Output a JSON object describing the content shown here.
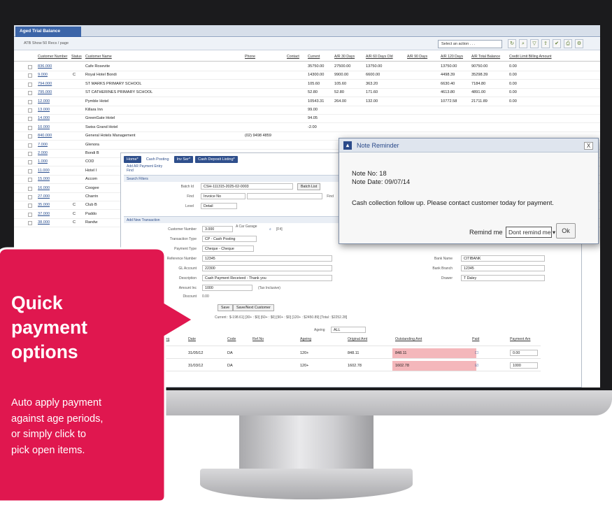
{
  "app": {
    "tab_title": "Aged Trial Balance",
    "toolbar_left": "ATB   Show  50  Recs / page",
    "action_select": "Select an action . . ."
  },
  "grid": {
    "columns": [
      "Customer Number",
      "Status",
      "Customer Name",
      "Phone",
      "Contact",
      "Current",
      "A/R 30 Days",
      "A/R 60 Days Old",
      "A/R 90 Days",
      "A/R 120 Days",
      "A/R Total Balance",
      "Credit Limit Billing Amount"
    ],
    "rows": [
      {
        "num": "836.000",
        "status": "",
        "name": "Cafe Rosevite",
        "phone": "",
        "current": "35750.00",
        "d30": "27500.00",
        "d60": "13750.00",
        "d120": "13750.00",
        "total": "90750.00",
        "credit": "0.00"
      },
      {
        "num": "9.000",
        "status": "C",
        "name": "Royal Hotel Bondi",
        "phone": "",
        "current": "14300.00",
        "d30": "9900.00",
        "d60": "6600.00",
        "d120": "4498.39",
        "total": "35298.39",
        "credit": "0.00"
      },
      {
        "num": "794.000",
        "status": "",
        "name": "ST MARKS PRIMARY SCHOOL",
        "phone": "",
        "current": "105.60",
        "d30": "105.60",
        "d60": "363.20",
        "d120": "6630.40",
        "total": "7184.80",
        "credit": "0.00"
      },
      {
        "num": "795.000",
        "status": "",
        "name": "ST CATHERINES PRIMARY SCHOOL",
        "phone": "",
        "current": "52.80",
        "d30": "52.80",
        "d60": "171.60",
        "d120": "4613.80",
        "total": "4891.00",
        "credit": "0.00"
      },
      {
        "num": "12.000",
        "status": "",
        "name": "Pymble Hotel",
        "phone": "",
        "current": "10543.31",
        "d30": "264.00",
        "d60": "132.00",
        "d120": "10772.58",
        "total": "21711.89",
        "credit": "0.00"
      },
      {
        "num": "13.000",
        "status": "",
        "name": "Killara Inn",
        "phone": "",
        "current": "99.00",
        "d30": "",
        "d60": "",
        "d120": "",
        "total": "",
        "credit": ""
      },
      {
        "num": "14.000",
        "status": "",
        "name": "GreenGate Hotel",
        "phone": "",
        "current": "94.05",
        "d30": "",
        "d60": "",
        "d120": "",
        "total": "",
        "credit": ""
      },
      {
        "num": "10.000",
        "status": "",
        "name": "Swiss Grand Hotel",
        "phone": "",
        "current": "-2.00",
        "d30": "",
        "d60": "",
        "d120": "",
        "total": "",
        "credit": ""
      },
      {
        "num": "840.000",
        "status": "",
        "name": "General Hotels Management",
        "phone": "(02) 9498 4859",
        "current": "",
        "d30": "",
        "d60": "",
        "d120": "",
        "total": "",
        "credit": ""
      },
      {
        "num": "7.000",
        "status": "",
        "name": "Glenora",
        "phone": "",
        "current": "",
        "d30": "",
        "d60": "",
        "d120": "",
        "total": "",
        "credit": ""
      },
      {
        "num": "2.000",
        "status": "",
        "name": "Bondi B",
        "phone": "",
        "current": "",
        "d30": "",
        "d60": "",
        "d120": "",
        "total": "",
        "credit": ""
      },
      {
        "num": "1.000",
        "status": "",
        "name": "COD",
        "phone": "",
        "current": "",
        "d30": "",
        "d60": "",
        "d120": "",
        "total": "",
        "credit": ""
      },
      {
        "num": "11.000",
        "status": "",
        "name": "Hotel I",
        "phone": "",
        "current": "",
        "d30": "",
        "d60": "",
        "d120": "",
        "total": "",
        "credit": ""
      },
      {
        "num": "15.000",
        "status": "",
        "name": "Accom",
        "phone": "",
        "current": "",
        "d30": "",
        "d60": "",
        "d120": "",
        "total": "",
        "credit": ""
      },
      {
        "num": "16.000",
        "status": "",
        "name": "Coogee",
        "phone": "",
        "current": "",
        "d30": "",
        "d60": "",
        "d120": "",
        "total": "",
        "credit": ""
      },
      {
        "num": "27.000",
        "status": "",
        "name": "Charrin",
        "phone": "",
        "current": "",
        "d30": "",
        "d60": "",
        "d120": "",
        "total": "",
        "credit": ""
      },
      {
        "num": "35.000",
        "status": "C",
        "name": "Club B",
        "phone": "",
        "current": "",
        "d30": "",
        "d60": "",
        "d120": "",
        "total": "",
        "credit": ""
      },
      {
        "num": "37.000",
        "status": "C",
        "name": "Paddo",
        "phone": "",
        "current": "",
        "d30": "",
        "d60": "",
        "d120": "",
        "total": "",
        "credit": ""
      },
      {
        "num": "38.000",
        "status": "C",
        "name": "Randw",
        "phone": "",
        "current": "",
        "d30": "",
        "d60": "",
        "d120": "",
        "total": "",
        "credit": ""
      }
    ]
  },
  "cash_window": {
    "menu": [
      "Home*",
      "Cash Posting",
      "Inv Ser*",
      "Cash Deposit Listing*"
    ],
    "sub_links": [
      "Add AR Payment Entry",
      "Find"
    ],
    "search_section": "Search Filters",
    "batch_label": "Batch Id",
    "batch_value": "CSH-111315-2025-02-0003",
    "batch_list": "Batch List",
    "find_label": "Find",
    "find_value": "Invoice No",
    "find_btn": "Find",
    "level_label": "Level",
    "level_value": "Detail",
    "add_section": "Add New Transaction",
    "customer_label": "Customer Number",
    "customer_value": "3.000",
    "customer_name": "A Car Garage",
    "f4": "[F4]",
    "trans_label": "Transaction Type",
    "trans_value": "CP - Cash Posting",
    "paytype_label": "Payment Type",
    "paytype_value": "Cheque - Cheque",
    "ref_label": "Reference Number",
    "ref_value": "12345",
    "gl_label": "GL Account",
    "gl_value": "22300",
    "desc_label": "Description",
    "desc_value": "Cash Payment Received - Thank you",
    "amount_label": "Amount Inc",
    "amount_value": "1000",
    "tax_note": "(Tax Inclusive)",
    "disc_label": "Discount",
    "disc_value": "0.00",
    "bank_name_label": "Bank Name",
    "bank_name_value": "CITIBANK",
    "bank_branch_label": "Bank Branch",
    "bank_branch_value": "12345",
    "drawer_label": "Drawer",
    "drawer_value": "T Daley",
    "save": "Save",
    "save_next": "Save/Next Customer",
    "summary": "Current : $-198.61] [30+ : $0] [60+ : $0] [90+ : $0] [120+ : $2450.89] [Total : $2252.28]",
    "ageing_label": "Ageing",
    "ageing_value": "ALL",
    "age_cols": [
      "Seq",
      "Date",
      "Code",
      "Ref.No",
      "Ageing",
      "Original Amt",
      "Outstanding Amt",
      "Paid",
      "Payment Am"
    ],
    "age_rows": [
      {
        "seq": "0",
        "date": "31/05/12",
        "code": "DA",
        "ref": "",
        "ageing": "120+",
        "orig": "848.11",
        "out": "848.11",
        "paid": false,
        "pay": "0.00"
      },
      {
        "seq": "0",
        "date": "31/03/12",
        "code": "DA",
        "ref": "",
        "ageing": "120+",
        "orig": "1602.78",
        "out": "1602.78",
        "paid": true,
        "pay": "1000"
      }
    ]
  },
  "note": {
    "title": "Note Reminder",
    "note_no": "Note No: 18",
    "note_date": "Note Date: 09/07/14",
    "message": "Cash collection follow up. Please contact customer today for payment.",
    "remind_label": "Remind me",
    "remind_value": "Dont remind me",
    "ok": "Ok",
    "close": "X"
  },
  "callout": {
    "heading": [
      "Quick",
      "payment",
      "options"
    ],
    "body": [
      "Auto apply payment",
      "against age periods,",
      "or simply click to",
      "pick open items."
    ],
    "color": "#e0174f"
  }
}
